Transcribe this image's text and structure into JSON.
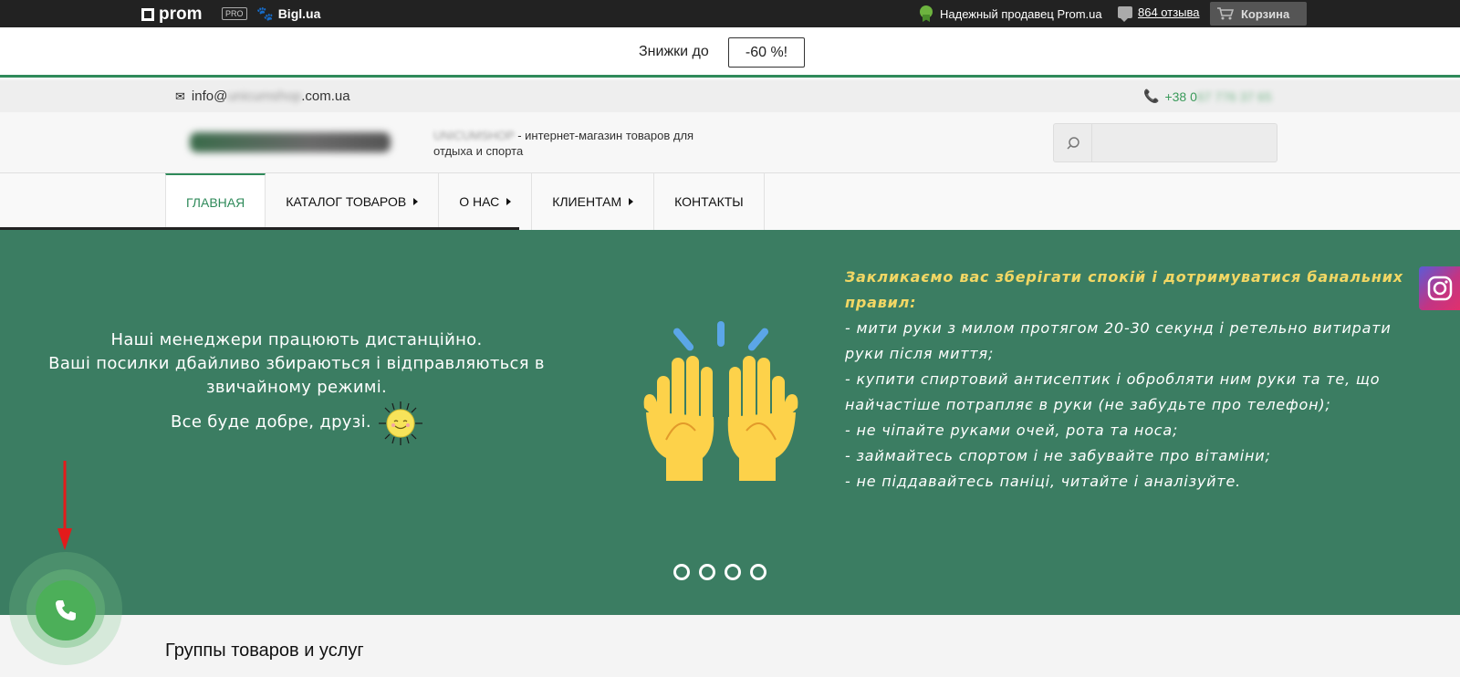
{
  "topbar": {
    "prom_label": "prom",
    "pro_badge": "PRO",
    "bigl_label": "Bigl.ua",
    "seller_label": "Надежный продавец Prom.ua",
    "reviews_label": "864 отзыва",
    "cart_label": "Корзина"
  },
  "promo": {
    "text": "Знижки до",
    "value": "-60 %!"
  },
  "contact": {
    "email_prefix": "info@",
    "email_hidden": "unicumshop",
    "email_suffix": ".com.ua",
    "phone_prefix": "+38 0",
    "phone_hidden": "67 776 37 65"
  },
  "header": {
    "shop_name_hidden": "UNICUMSHOP",
    "tagline": " - интернет-магазин товаров для отдыха и спорта",
    "search_placeholder": ""
  },
  "nav": {
    "items": [
      {
        "label": "ГЛАВНАЯ"
      },
      {
        "label": "КАТАЛОГ ТОВАРОВ"
      },
      {
        "label": "О НАС"
      },
      {
        "label": "КЛИЕНТАМ"
      },
      {
        "label": "КОНТАКТЫ"
      }
    ]
  },
  "banner": {
    "left_lines": [
      "Наші менеджери працюють дистанційно.",
      "Ваші посилки дбайливо збираються і відправляються в звичайному режимі.",
      "Все буде добре, друзі."
    ],
    "right_intro": "Закликаємо вас зберігати спокій і дотримуватися банальних правил:",
    "right_rules": [
      "- мити руки з милом протягом 20-30 секунд і ретельно витирати руки після миття;",
      "- купити спиртовий антисептик і обробляти ним руки та те, що найчастіше потрапляє в руки (не забудьте про телефон);",
      "- не чіпайте руками очей, рота та носа;",
      "- займайтесь спортом і не забувайте про вітаміни;",
      "- не піддавайтесь паніці, читайте і аналізуйте."
    ],
    "slide_count": 4
  },
  "groups": {
    "title": "Группы товаров и услуг"
  },
  "colors": {
    "brand_green": "#2f8a5a",
    "banner_bg": "#3b7d62",
    "accent_yellow": "#f2d764",
    "call_green": "#4caf59"
  },
  "icons": [
    "prom-logo-icon",
    "paw-icon",
    "medal-icon",
    "comment-icon",
    "cart-icon",
    "mail-icon",
    "phone-icon",
    "search-icon",
    "instagram-icon",
    "raised-hands-icon",
    "sun-icon",
    "call-icon",
    "red-arrow-icon"
  ]
}
